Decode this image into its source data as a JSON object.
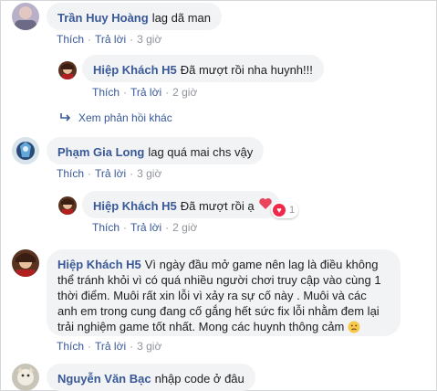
{
  "comments": [
    {
      "name": "Trần Huy Hoàng",
      "text": "lag dã man",
      "like": "Thích",
      "reply": "Trả lời",
      "time": "3 giờ"
    },
    {
      "name": "Hiệp Khách H5",
      "text": "Đã mượt rồi nha huynh!!!",
      "like": "Thích",
      "reply": "Trả lời",
      "time": "2 giờ"
    },
    {
      "name": "Phạm Gia Long",
      "text": "lag quá mai chs vậy",
      "like": "Thích",
      "reply": "Trả lời",
      "time": "3 giờ"
    },
    {
      "name": "Hiệp Khách H5",
      "text": "Đã mượt rồi ạ",
      "like": "Thích",
      "reply": "Trả lời",
      "time": "2 giờ",
      "reaction_count": "1"
    },
    {
      "name": "Hiệp Khách H5",
      "text": "Vì ngày đầu mở game nên lag là điều không thể tránh khỏi vì có quá nhiều người chơi truy cập vào cùng 1 thời điểm. Muôi rất xin lỗi vì xảy ra sự cố này . Muôi và các anh em trong cung đang cố gắng hết sức fix lỗi nhằm đem lại trải nghiệm game tốt nhất. Mong các huynh thông cảm",
      "like": "Thích",
      "reply": "Trả lời",
      "time": "3 giờ"
    },
    {
      "name": "Nguyễn Văn Bạc",
      "text": "nhập code ở đâu"
    }
  ],
  "more_replies": "Xem phản hồi khác",
  "colors": {
    "name": "#385898",
    "bubble": "#f2f3f5",
    "meta": "#90949c",
    "heart": "#f0284a"
  }
}
